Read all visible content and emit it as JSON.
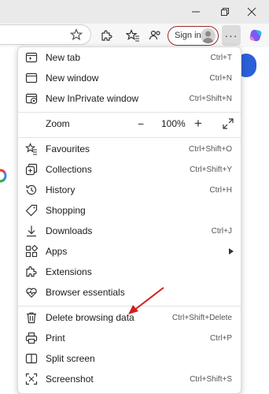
{
  "toolbar": {
    "signin_label": "Sign in",
    "more_label": "···"
  },
  "menu": {
    "new_tab": {
      "label": "New tab",
      "shortcut": "Ctrl+T"
    },
    "new_window": {
      "label": "New window",
      "shortcut": "Ctrl+N"
    },
    "new_inprivate": {
      "label": "New InPrivate window",
      "shortcut": "Ctrl+Shift+N"
    },
    "zoom": {
      "label": "Zoom",
      "minus": "−",
      "value": "100%",
      "plus": "+"
    },
    "favourites": {
      "label": "Favourites",
      "shortcut": "Ctrl+Shift+O"
    },
    "collections": {
      "label": "Collections",
      "shortcut": "Ctrl+Shift+Y"
    },
    "history": {
      "label": "History",
      "shortcut": "Ctrl+H"
    },
    "shopping": {
      "label": "Shopping"
    },
    "downloads": {
      "label": "Downloads",
      "shortcut": "Ctrl+J"
    },
    "apps": {
      "label": "Apps"
    },
    "extensions": {
      "label": "Extensions"
    },
    "browser_essentials": {
      "label": "Browser essentials"
    },
    "delete_browsing_data": {
      "label": "Delete browsing data",
      "shortcut": "Ctrl+Shift+Delete"
    },
    "print": {
      "label": "Print",
      "shortcut": "Ctrl+P"
    },
    "split_screen": {
      "label": "Split screen"
    },
    "screenshot": {
      "label": "Screenshot",
      "shortcut": "Ctrl+Shift+S"
    }
  },
  "colors": {
    "accent_red": "#9b2c2c",
    "annotation_arrow": "#d0201e",
    "page_blue": "#2a5fd8"
  }
}
